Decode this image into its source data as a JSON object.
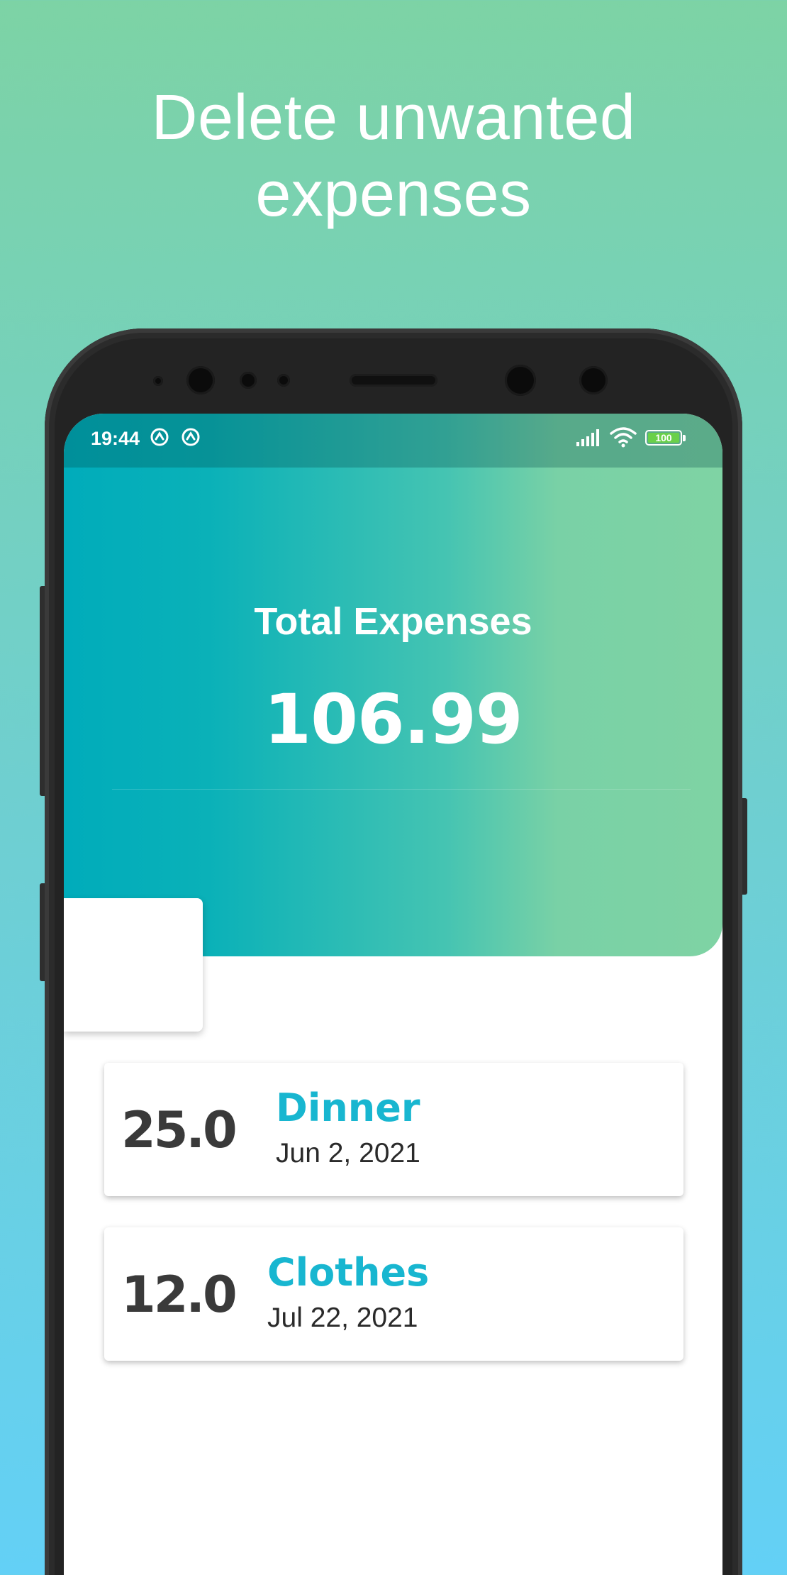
{
  "promo": {
    "headline_line1": "Delete unwanted",
    "headline_line2": "expenses"
  },
  "status_bar": {
    "time": "19:44",
    "battery": "100"
  },
  "summary": {
    "label": "Total Expenses",
    "value": "106.99"
  },
  "expenses": [
    {
      "amount": "25.0",
      "title": "Dinner",
      "date": "Jun 2, 2021"
    },
    {
      "amount": "12.0",
      "title": "Clothes",
      "date": "Jul 22, 2021"
    }
  ],
  "colors": {
    "background_top": "#7dd3a5",
    "background_bottom": "#63d0f6",
    "header_start": "#00acbb",
    "header_end": "#7fd3a4",
    "title_accent": "#18b6d0",
    "amount_text": "#3a3a3a"
  }
}
